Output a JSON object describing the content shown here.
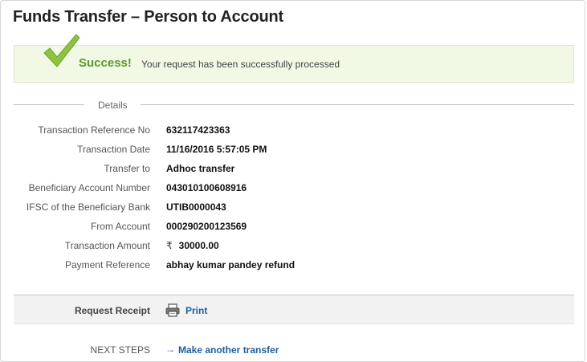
{
  "page": {
    "title": "Funds Transfer – Person to Account"
  },
  "success": {
    "heading": "Success!",
    "message": "Your request has been successfully processed",
    "icon": "checkmark-icon",
    "color": "#5c9a2a"
  },
  "details": {
    "section_label": "Details",
    "rows": [
      {
        "label": "Transaction Reference No",
        "value": "632117423363"
      },
      {
        "label": "Transaction Date",
        "value": "11/16/2016 5:57:05 PM"
      },
      {
        "label": "Transfer to",
        "value": "Adhoc transfer"
      },
      {
        "label": "Beneficiary Account Number",
        "value": "043010100608916"
      },
      {
        "label": "IFSC of the Beneficiary Bank",
        "value": "UTIB0000043"
      },
      {
        "label": "From Account",
        "value": "000290200123569"
      },
      {
        "label": "Transaction Amount",
        "currency": "₹",
        "value": "30000.00"
      },
      {
        "label": "Payment Reference",
        "value": "abhay kumar pandey refund"
      }
    ]
  },
  "receipt": {
    "label": "Request Receipt",
    "icon": "printer-icon",
    "print_label": "Print"
  },
  "next_steps": {
    "label": "NEXT STEPS",
    "arrow": "→",
    "link_label": "Make another transfer",
    "link_color": "#1d5e9f"
  }
}
